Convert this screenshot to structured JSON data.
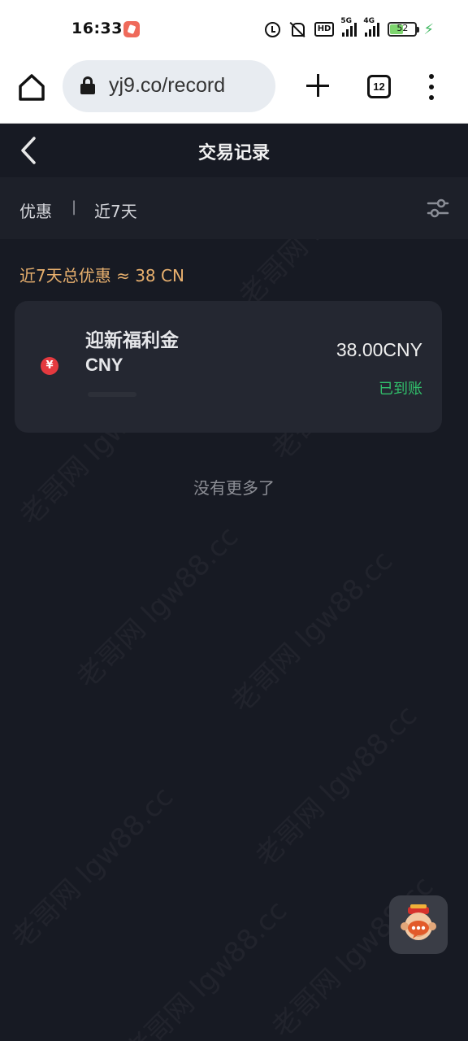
{
  "status_bar": {
    "time": "16:33",
    "battery": "52",
    "network_5g": "5G",
    "network_4g": "4G",
    "hd": "HD"
  },
  "browser": {
    "url": "yj9.co/record",
    "tab_count": "12"
  },
  "header": {
    "title": "交易记录"
  },
  "filter": {
    "type": "优惠",
    "separator": "|",
    "range": "近7天"
  },
  "summary": "近7天总优惠 ≈ 38 CN",
  "record": {
    "name": "迎新福利金",
    "currency": "CNY",
    "amount": "38.00CNY",
    "status": "已到账",
    "currency_symbol": "¥"
  },
  "list_end": "没有更多了",
  "colors": {
    "background": "#171a23",
    "card": "#242731",
    "accent_orange": "#e8b06e",
    "status_green": "#31c06b",
    "icon_red": "#e4393f"
  }
}
